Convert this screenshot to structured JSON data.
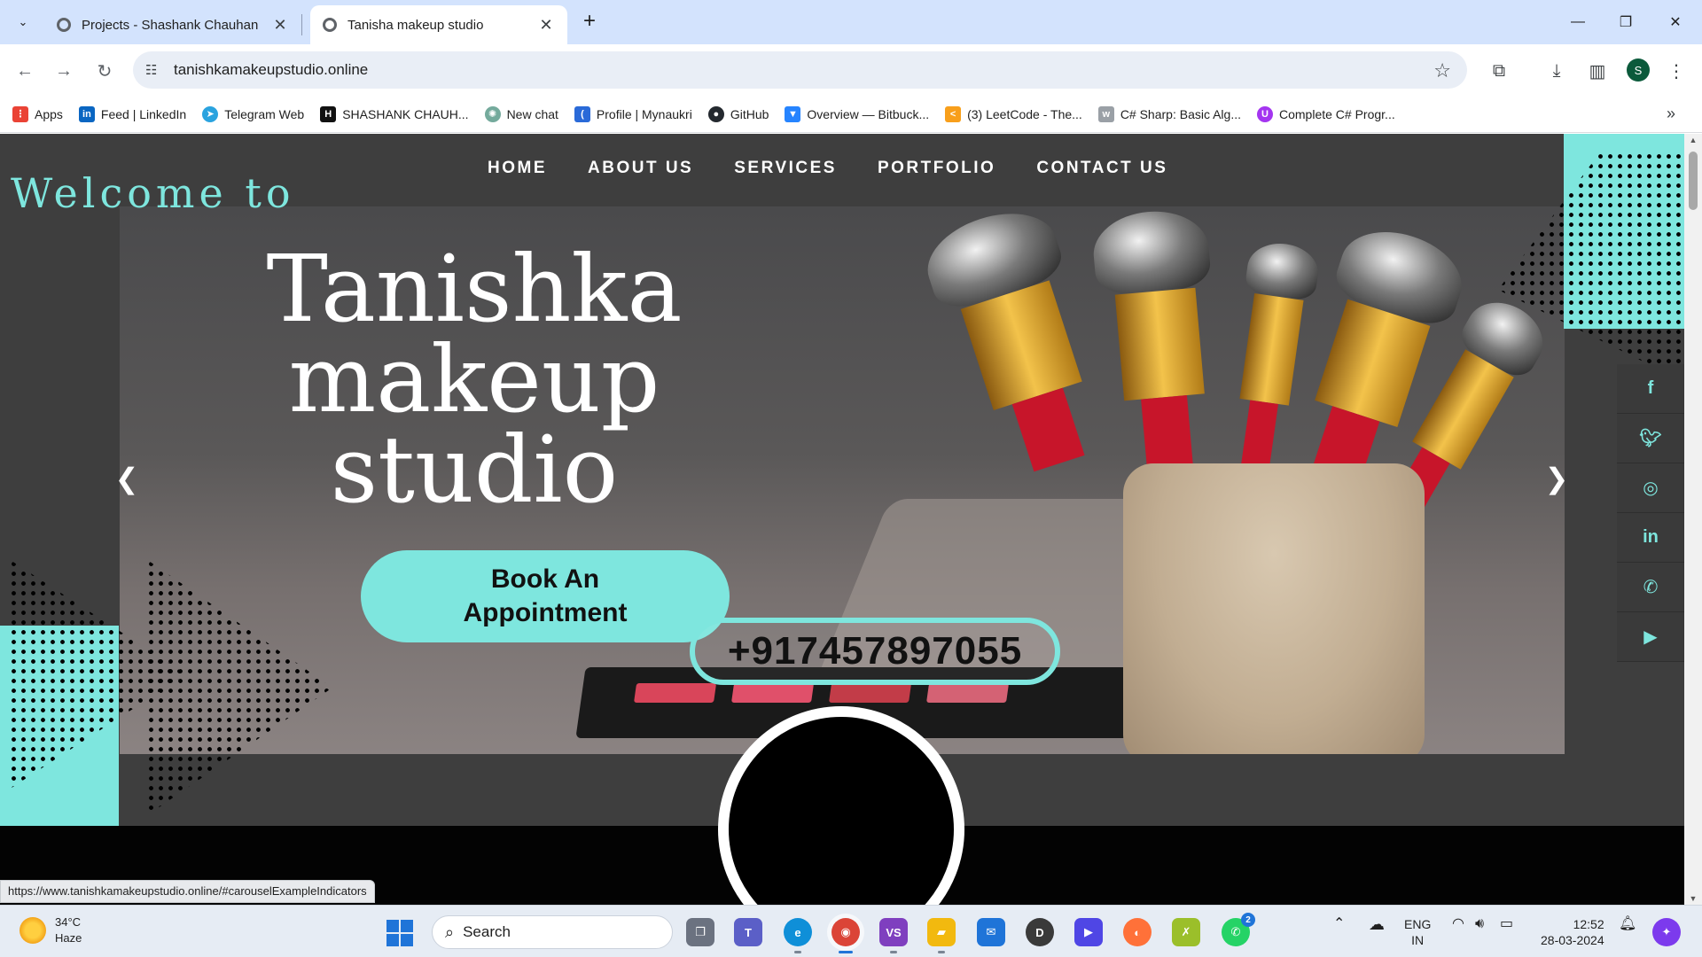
{
  "browser": {
    "tabs": [
      {
        "title": "Projects - Shashank Chauhan",
        "active": false
      },
      {
        "title": "Tanisha makeup studio",
        "active": true
      }
    ],
    "url": "tanishkamakeupstudio.online",
    "profile_initial": "S",
    "bookmarks": [
      {
        "label": "Apps",
        "icon": "apps-grid-icon",
        "color": "#ea4335"
      },
      {
        "label": "Feed | LinkedIn",
        "icon": "linkedin-icon",
        "color": "#0a66c2"
      },
      {
        "label": "Telegram Web",
        "icon": "telegram-icon",
        "color": "#2aa3df"
      },
      {
        "label": "SHASHANK CHAUH...",
        "icon": "hackerrank-icon",
        "color": "#111111"
      },
      {
        "label": "New chat",
        "icon": "chatgpt-icon",
        "color": "#74aa9c"
      },
      {
        "label": "Profile | Mynaukri",
        "icon": "naukri-icon",
        "color": "#2a6ad8"
      },
      {
        "label": "GitHub",
        "icon": "github-icon",
        "color": "#24292f"
      },
      {
        "label": "Overview — Bitbuck...",
        "icon": "bitbucket-icon",
        "color": "#2684ff"
      },
      {
        "label": "(3) LeetCode - The...",
        "icon": "leetcode-icon",
        "color": "#f89f1b"
      },
      {
        "label": "C# Sharp: Basic Alg...",
        "icon": "w3resource-icon",
        "color": "#9aa0a6"
      },
      {
        "label": "Complete C# Progr...",
        "icon": "udemy-icon",
        "color": "#a435f0"
      }
    ],
    "status_url": "https://www.tanishkamakeupstudio.online/#carouselExampleIndicators"
  },
  "site": {
    "nav": [
      "HOME",
      "ABOUT US",
      "SERVICES",
      "PORTFOLIO",
      "CONTACT US"
    ],
    "welcome": "Welcome to",
    "title_lines": [
      "Tanishka",
      "makeup",
      "studio"
    ],
    "book_button_lines": [
      "Book An",
      "Appointment"
    ],
    "phone": "+917457897055",
    "social": [
      "facebook-icon",
      "twitter-icon",
      "instagram-icon",
      "linkedin-icon",
      "whatsapp-icon",
      "youtube-icon"
    ],
    "accent_color": "#7ee6de"
  },
  "taskbar": {
    "weather_temp": "34°C",
    "weather_desc": "Haze",
    "search_placeholder": "Search",
    "language": "ENG",
    "region": "IN",
    "time": "12:52",
    "date": "28-03-2024",
    "whatsapp_badge": "2"
  }
}
